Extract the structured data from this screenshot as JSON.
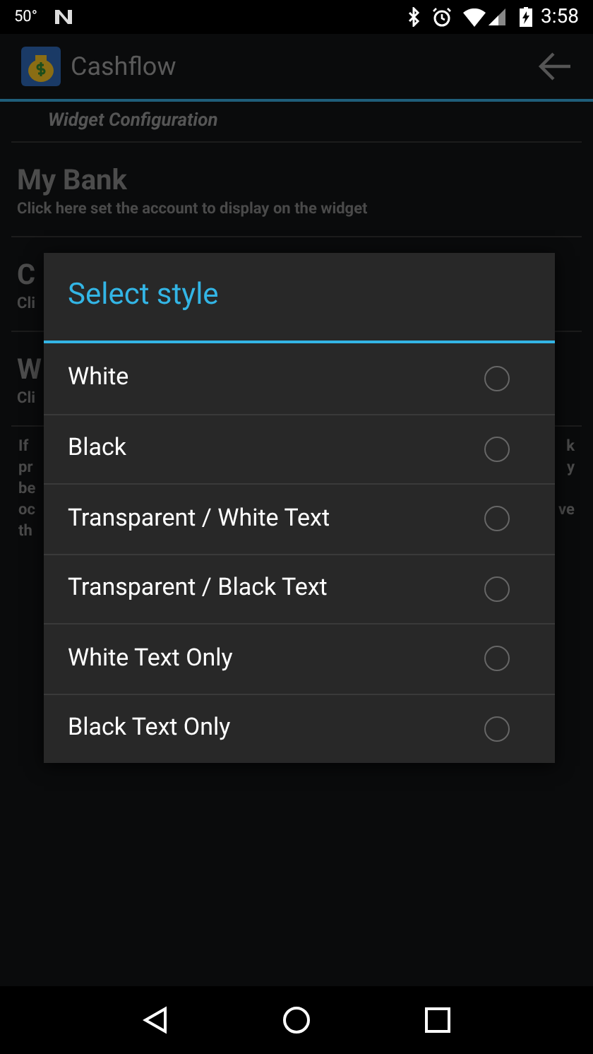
{
  "status_bar": {
    "temperature": "50°",
    "time": "3:58"
  },
  "app_bar": {
    "title": "Cashflow"
  },
  "section_header": "Widget Configuration",
  "settings": [
    {
      "title": "My Bank",
      "subtitle": "Click here set the account to display on the widget"
    },
    {
      "title": "C",
      "subtitle": "Cli"
    },
    {
      "title": "W",
      "subtitle": "Cli"
    }
  ],
  "note_lines": [
    {
      "left": "If",
      "right": "k"
    },
    {
      "left": "pr",
      "right": "y"
    },
    {
      "left": "be"
    },
    {
      "left": "oc",
      "right": "ve"
    },
    {
      "left": "th"
    }
  ],
  "dialog": {
    "title": "Select style",
    "options": [
      {
        "label": "White",
        "selected": false
      },
      {
        "label": "Black",
        "selected": false
      },
      {
        "label": "Transparent / White Text",
        "selected": false
      },
      {
        "label": "Transparent / Black Text",
        "selected": false
      },
      {
        "label": "White Text Only",
        "selected": false
      },
      {
        "label": "Black Text Only",
        "selected": false
      }
    ]
  }
}
